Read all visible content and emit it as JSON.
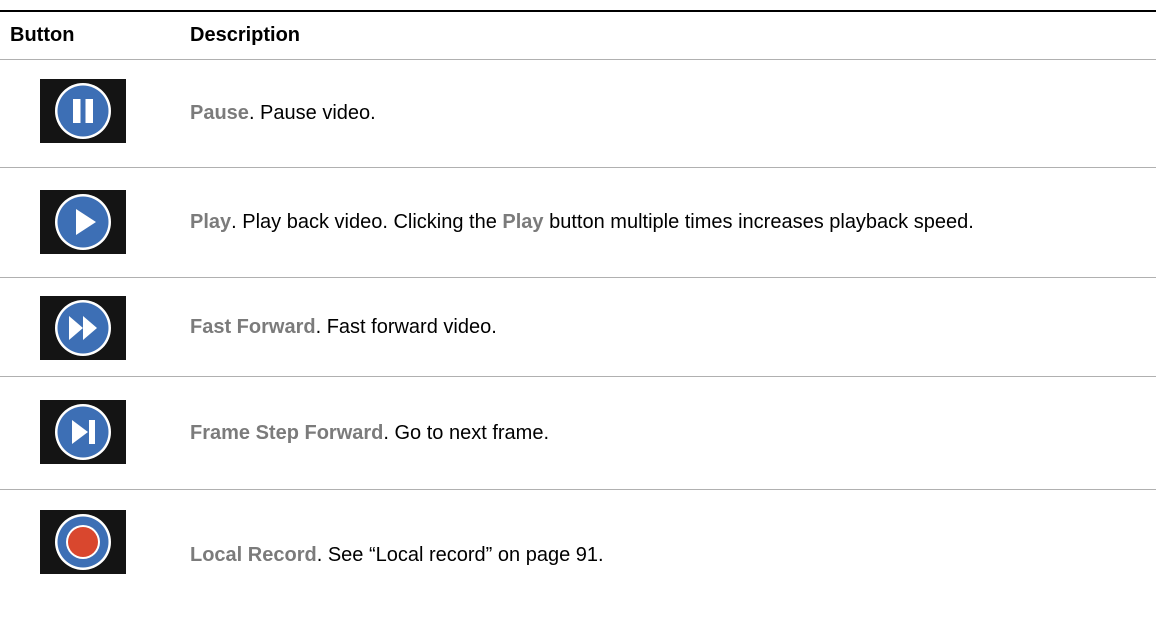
{
  "table": {
    "headers": {
      "button": "Button",
      "description": "Description"
    },
    "rows": [
      {
        "icon": "pause-icon",
        "term": "Pause",
        "text": ". Pause video."
      },
      {
        "icon": "play-icon",
        "term": "Play",
        "text_a": ". Play back video. Clicking the ",
        "term2": "Play",
        "text_b": " button multiple times increases playback speed."
      },
      {
        "icon": "fast-forward-icon",
        "term": "Fast Forward",
        "text": ". Fast forward video."
      },
      {
        "icon": "frame-step-forward-icon",
        "term": "Frame Step Forward",
        "text": ". Go to next frame."
      },
      {
        "icon": "local-record-icon",
        "term": "Local Record",
        "text": ". See “Local record” on page 91."
      }
    ]
  },
  "colors": {
    "icon_blue": "#3d6fb5",
    "icon_ring": "#ffffff",
    "icon_background": "#141414",
    "record_red": "#d9472e",
    "term_gray": "#7b7b7b"
  }
}
